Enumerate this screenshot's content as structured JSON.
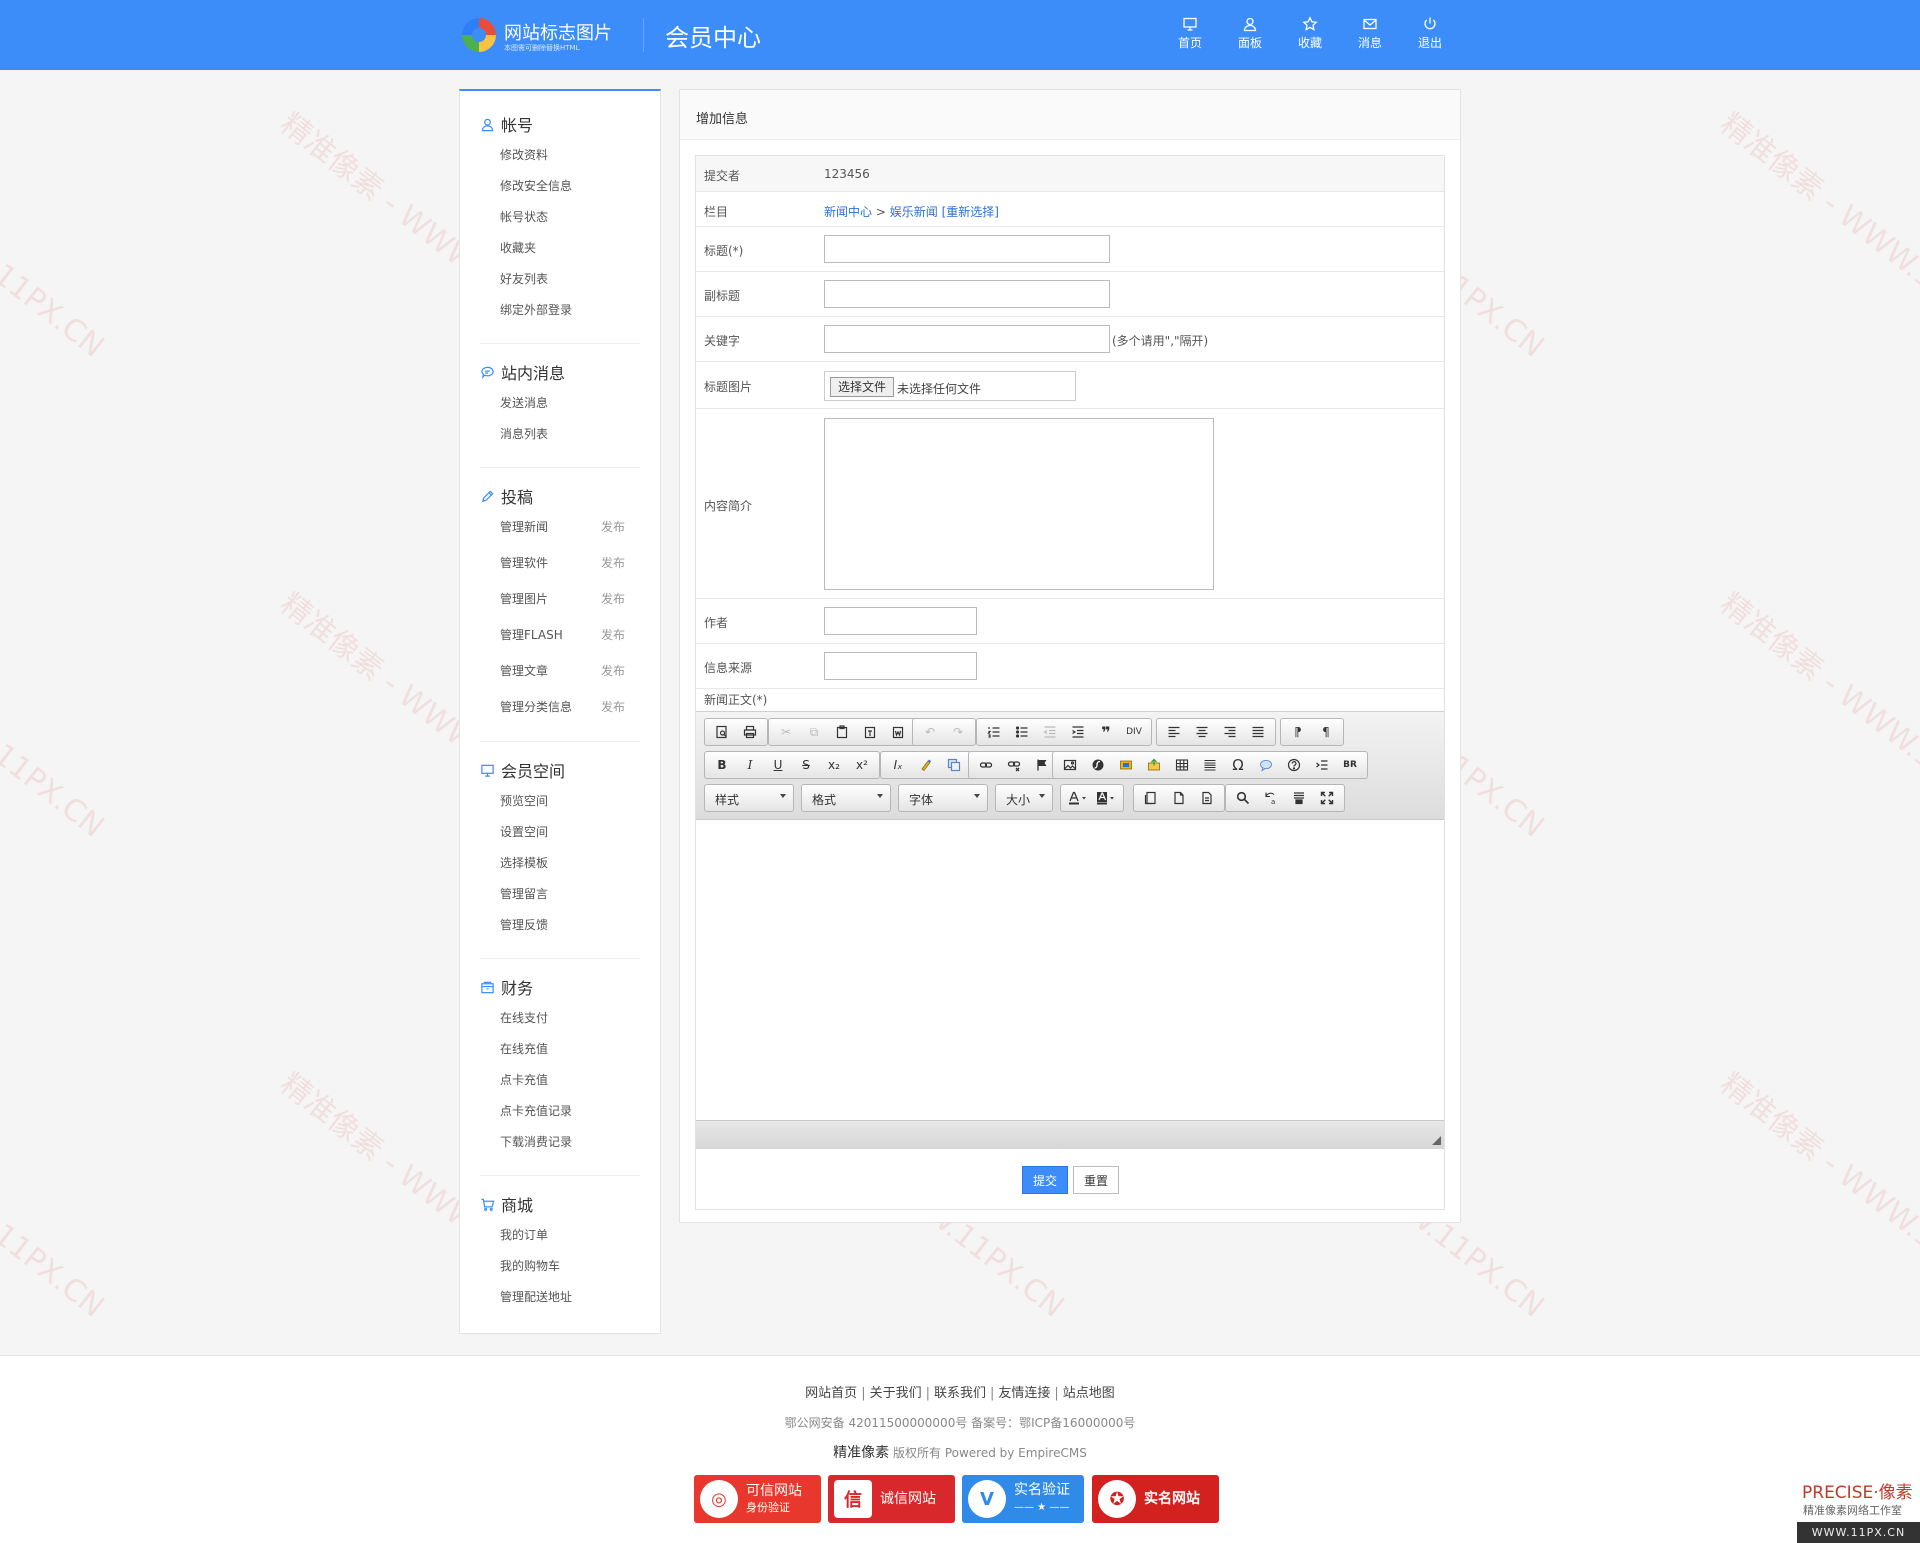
{
  "header": {
    "logo_title": "网站标志图片",
    "logo_sub": "本图需可删除替换HTML",
    "page_title": "会员中心",
    "nav": [
      {
        "label": "首页",
        "icon": "monitor-icon"
      },
      {
        "label": "面板",
        "icon": "user-icon"
      },
      {
        "label": "收藏",
        "icon": "star-icon"
      },
      {
        "label": "消息",
        "icon": "mail-icon"
      },
      {
        "label": "退出",
        "icon": "power-icon"
      }
    ]
  },
  "sidebar": {
    "groups": [
      {
        "title": "帐号",
        "icon": "user-icon",
        "items": [
          "修改资料",
          "修改安全信息",
          "帐号状态",
          "收藏夹",
          "好友列表",
          "绑定外部登录"
        ]
      },
      {
        "title": "站内消息",
        "icon": "chat-icon",
        "items": [
          "发送消息",
          "消息列表"
        ]
      },
      {
        "title": "投稿",
        "icon": "pencil-icon",
        "items": [
          "管理新闻",
          "管理软件",
          "管理图片",
          "管理FLASH",
          "管理文章",
          "管理分类信息"
        ],
        "publish_label": "发布"
      },
      {
        "title": "会员空间",
        "icon": "computer-icon",
        "items": [
          "预览空间",
          "设置空间",
          "选择模板",
          "管理留言",
          "管理反馈"
        ]
      },
      {
        "title": "财务",
        "icon": "wallet-icon",
        "items": [
          "在线支付",
          "在线充值",
          "点卡充值",
          "点卡充值记录",
          "下载消费记录"
        ]
      },
      {
        "title": "商城",
        "icon": "cart-icon",
        "items": [
          "我的订单",
          "我的购物车",
          "管理配送地址"
        ]
      }
    ]
  },
  "main": {
    "title": "增加信息",
    "form": {
      "submitter_label": "提交者",
      "submitter_value": "123456",
      "column_label": "栏目",
      "column_path": [
        "新闻中心",
        "娱乐新闻"
      ],
      "column_sep": ">",
      "column_reselect": "[重新选择]",
      "title_label": "标题(*)",
      "subtitle_label": "副标题",
      "keywords_label": "关键字",
      "keywords_hint": "(多个请用\",\"隔开)",
      "title_image_label": "标题图片",
      "file_button": "选择文件",
      "file_status": "未选择任何文件",
      "summary_label": "内容简介",
      "author_label": "作者",
      "source_label": "信息来源",
      "body_label": "新闻正文(*)"
    },
    "editor": {
      "combos": [
        "样式",
        "格式",
        "字体",
        "大小"
      ]
    },
    "submit_label": "提交",
    "reset_label": "重置"
  },
  "footer": {
    "links": [
      "网站首页",
      "关于我们",
      "联系我们",
      "友情连接",
      "站点地图"
    ],
    "icp": "鄂公网安备 42011500000000号 备案号：鄂ICP备16000000号",
    "brand": "精准像素",
    "power": "版权所有 Powered by EmpireCMS",
    "badges": [
      {
        "line1": "可信网站",
        "line2": "身份验证",
        "color": "#e8372c"
      },
      {
        "line1": "诚信网站",
        "line2": "",
        "color": "#d8282b"
      },
      {
        "line1": "实名验证",
        "line2": "—— ★ ——",
        "color": "#2f8ae8"
      },
      {
        "line1": "实名网站",
        "line2": "",
        "color": "#d2211f"
      }
    ],
    "corner_brand": "PRECISE·像素",
    "corner_sub": "精准像素网络工作室",
    "corner_url": "WWW.11PX.CN"
  },
  "watermark": {
    "text": "精准像素 - WWW.11PX.CN"
  },
  "colors": {
    "primary": "#3c8dfa",
    "link": "#2f6fd8"
  }
}
